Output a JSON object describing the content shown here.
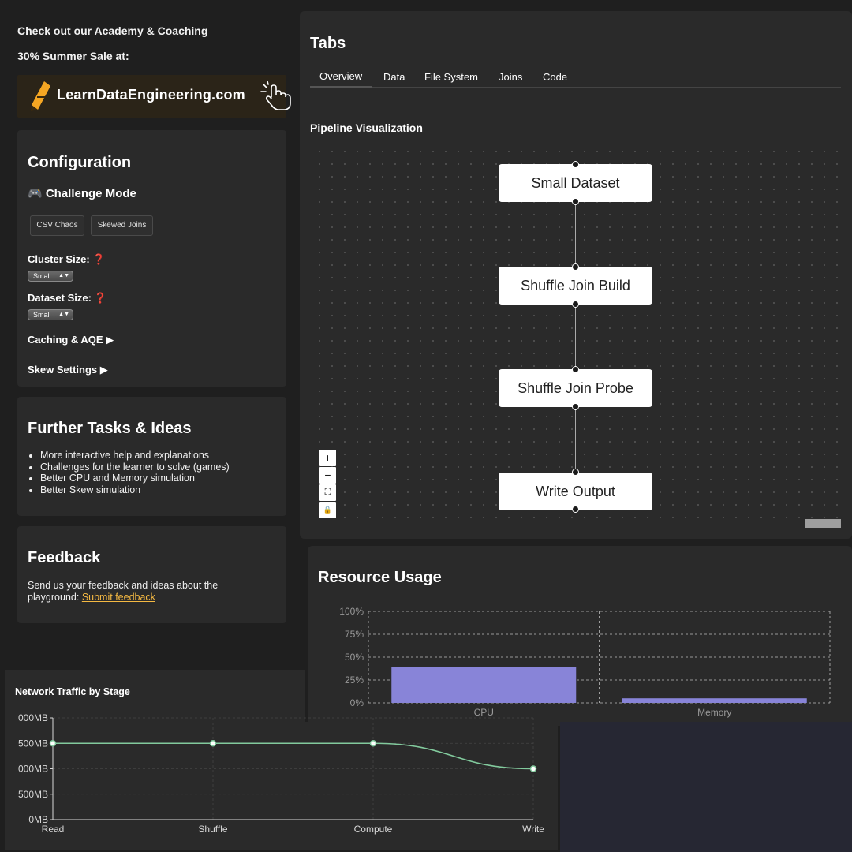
{
  "sidebar": {
    "promo_line1": "Check out our Academy & Coaching",
    "promo_line2": "30% Summer Sale at:",
    "banner_text": "LearnDataEngineering.com",
    "configuration": {
      "title": "Configuration",
      "challenge_mode": "🎮 Challenge Mode",
      "challenge_buttons": [
        "CSV Chaos",
        "Skewed Joins"
      ],
      "cluster_size_label": "Cluster Size:",
      "cluster_size_value": "Small",
      "dataset_size_label": "Dataset Size:",
      "dataset_size_value": "Small",
      "help_mark": "❓",
      "caching_label": "Caching & AQE ▶",
      "skew_label": "Skew Settings ▶"
    },
    "further": {
      "title": "Further Tasks & Ideas",
      "items": [
        "More interactive help and explanations",
        "Challenges for the learner to solve (games)",
        "Better CPU and Memory simulation",
        "Better Skew simulation"
      ]
    },
    "feedback": {
      "title": "Feedback",
      "text_line1": "Send us your feedback and ideas about the",
      "text_line2": "playground:",
      "link_label": "Submit feedback"
    }
  },
  "tabs_panel": {
    "title": "Tabs",
    "tabs": [
      "Overview",
      "Data",
      "File System",
      "Joins",
      "Code"
    ],
    "active_tab": "Overview",
    "section_title": "Pipeline Visualization",
    "nodes": [
      "Small Dataset",
      "Shuffle Join Build",
      "Shuffle Join Probe",
      "Write Output"
    ],
    "controls": [
      "+",
      "−",
      "⛶",
      "🔒"
    ]
  },
  "resource_usage": {
    "title": "Resource Usage",
    "color": "#8884d8",
    "chart_data": {
      "type": "bar",
      "categories": [
        "CPU",
        "Memory"
      ],
      "values": [
        39,
        5
      ],
      "ylim": [
        0,
        100
      ],
      "yticks": [
        "0%",
        "25%",
        "50%",
        "75%",
        "100%"
      ],
      "grid": true
    }
  },
  "network_traffic": {
    "title": "Network Traffic by Stage",
    "color": "#82ca9d",
    "chart_data": {
      "type": "line",
      "categories": [
        "Read",
        "Shuffle",
        "Compute",
        "Write"
      ],
      "values": [
        1500,
        1500,
        1500,
        1000
      ],
      "ylim": [
        0,
        2000
      ],
      "yticks": [
        "0MB",
        "500MB",
        "000MB",
        "500MB",
        "000MB"
      ],
      "grid": true
    }
  }
}
